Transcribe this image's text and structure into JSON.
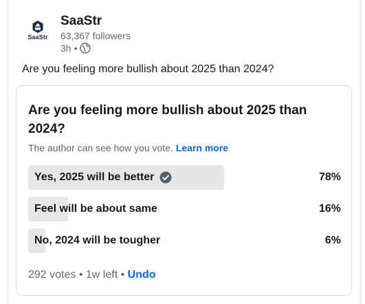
{
  "author": {
    "logo_text": "SaaStr",
    "name": "SaaStr",
    "followers": "63,367 followers",
    "time": "3h",
    "separator": "•"
  },
  "post": {
    "text": "Are you feeling more bullish about 2025 than 2024?"
  },
  "poll": {
    "question": "Are you feeling more bullish about 2025 than 2024?",
    "note": "The author can see how you vote.",
    "learn_more": "Learn more",
    "options": [
      {
        "label": "Yes, 2025 will be better",
        "percent_text": "78%",
        "fraction": 0.78,
        "selected": true
      },
      {
        "label": "Feel will be about same",
        "percent_text": "16%",
        "fraction": 0.16,
        "selected": false
      },
      {
        "label": "No, 2024 will be tougher",
        "percent_text": "6%",
        "fraction": 0.06,
        "selected": false
      }
    ],
    "votes": "292 votes",
    "time_left": "1w left",
    "dot": "•",
    "undo": "Undo"
  },
  "icons": {
    "globe": "globe-icon",
    "check": "check-circle-icon",
    "logo": "saastr-logo-icon"
  },
  "colors": {
    "link": "#0a66c2",
    "bar": "#e6e6e6",
    "muted": "#666666"
  }
}
